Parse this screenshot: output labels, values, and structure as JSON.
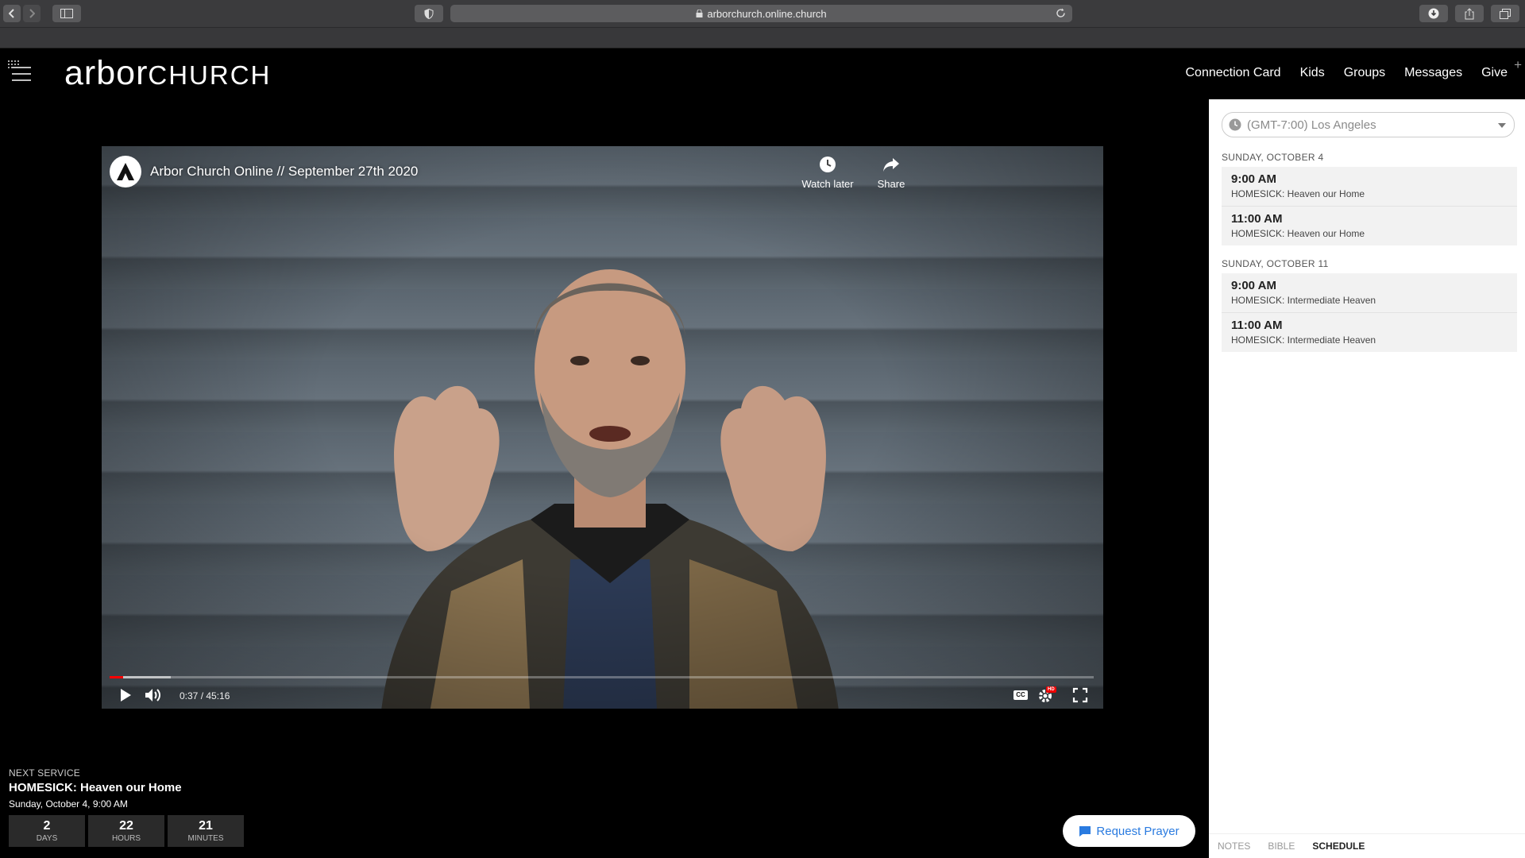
{
  "browser": {
    "url": "arborchurch.online.church"
  },
  "site": {
    "logo_part1": "arbor",
    "logo_part2": "CHURCH",
    "nav": [
      "Connection Card",
      "Kids",
      "Groups",
      "Messages",
      "Give"
    ]
  },
  "video": {
    "title": "Arbor Church Online // September 27th 2020",
    "watch_later": "Watch later",
    "share": "Share",
    "time": "0:37 / 45:16",
    "progress_fraction": 0.0136,
    "buffer_fraction": 0.062,
    "cc_label": "CC",
    "hd_badge": "HD"
  },
  "next_service": {
    "label": "NEXT SERVICE",
    "title": "HOMESICK: Heaven our Home",
    "date": "Sunday, October 4, 9:00 AM",
    "countdown": [
      {
        "value": "2",
        "unit": "DAYS"
      },
      {
        "value": "22",
        "unit": "HOURS"
      },
      {
        "value": "21",
        "unit": "MINUTES"
      }
    ]
  },
  "prayer_button": "Request Prayer",
  "schedule": {
    "timezone": "(GMT-7:00) Los Angeles",
    "days": [
      {
        "label": "SUNDAY, OCTOBER 4",
        "slots": [
          {
            "time": "9:00 AM",
            "desc": "HOMESICK: Heaven our Home"
          },
          {
            "time": "11:00 AM",
            "desc": "HOMESICK: Heaven our Home"
          }
        ]
      },
      {
        "label": "SUNDAY, OCTOBER 11",
        "slots": [
          {
            "time": "9:00 AM",
            "desc": "HOMESICK: Intermediate Heaven"
          },
          {
            "time": "11:00 AM",
            "desc": "HOMESICK: Intermediate Heaven"
          }
        ]
      }
    ],
    "tabs": [
      "NOTES",
      "BIBLE",
      "SCHEDULE"
    ],
    "active_tab": "SCHEDULE"
  },
  "colors": {
    "accent_blue": "#2a7be0",
    "progress_red": "#ff0000"
  }
}
